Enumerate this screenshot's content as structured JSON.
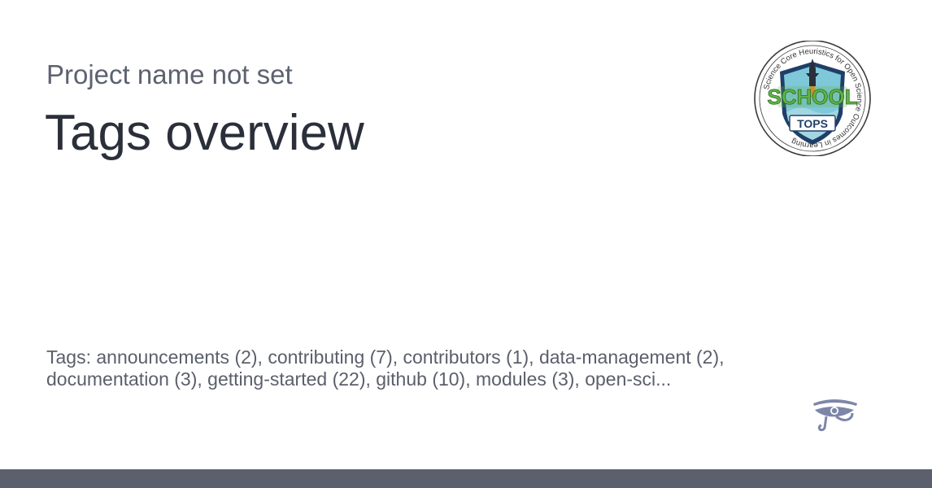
{
  "header": {
    "project_name": "Project name not set",
    "title": "Tags overview"
  },
  "logo": {
    "ring_text": "Science Core Heuristics for Open Science Outcomes in Learning",
    "word_top": "SCHOOL",
    "word_bottom": "TOPS",
    "icon": "school-tops-badge-icon"
  },
  "tags": {
    "prefix": "Tags:",
    "text": "announcements (2), contributing (7), contributors (1), data-management (2), documentation (3), getting-started (22), github (10), modules (3), open-sci..."
  },
  "footer": {
    "icon": "eye-of-horus-icon",
    "bar_color": "#5b606c"
  },
  "colors": {
    "title": "#2a2f3a",
    "subtitle": "#5d6270",
    "text": "#5a5f6b",
    "badge_green": "#5fb446",
    "badge_navy": "#1f3f68"
  }
}
